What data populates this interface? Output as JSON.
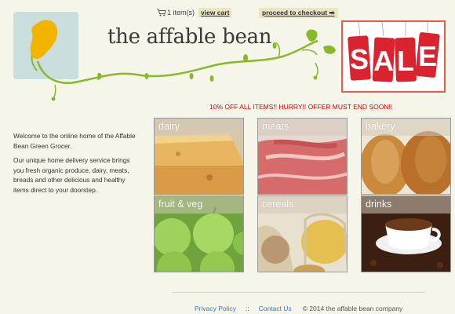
{
  "header": {
    "title": "the affable bean",
    "cart_count": "1 item(s)",
    "view_cart": "view cart",
    "checkout": "proceed to checkout ➡",
    "promo": "10% OFF ALL ITEMS!! HURRY!! OFFER MUST END SOON!!",
    "sale_letters": [
      "S",
      "A",
      "L",
      "E"
    ]
  },
  "welcome": {
    "p1": "Welcome to the online home of the Affable Bean Green Grocer.",
    "p2": "Our unique home delivery service brings you fresh organic produce, dairy, meats, breads and other delicious and healthy items direct to your doorstep."
  },
  "categories": [
    {
      "label": "dairy"
    },
    {
      "label": "meats"
    },
    {
      "label": "bakery"
    },
    {
      "label": "fruit & veg"
    },
    {
      "label": "cereals"
    },
    {
      "label": "drinks"
    }
  ],
  "footer": {
    "privacy": "Privacy Policy",
    "separator": "::",
    "contact": "Contact Us",
    "copyright": "©  2014 the affable bean company"
  },
  "colors": {
    "background": "#f5f5ea",
    "promo": "#dd0000",
    "sale_red": "#d9232e",
    "vine_green": "#8ab82b"
  }
}
